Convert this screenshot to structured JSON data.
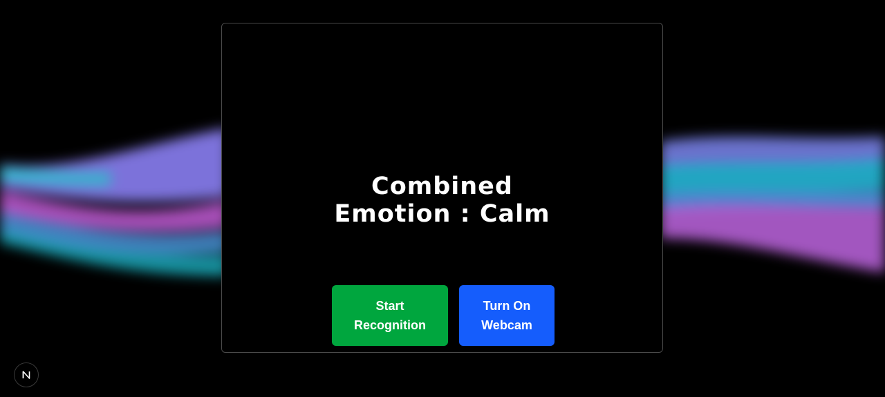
{
  "main": {
    "title_line1": "Combined",
    "title_line2": "Emotion : Calm"
  },
  "actions": {
    "start_label_line1": "Start",
    "start_label_line2": "Recognition",
    "webcam_label_line1": "Turn On",
    "webcam_label_line2": "Webcam"
  },
  "colors": {
    "background": "#000000",
    "start_button": "#00a63e",
    "webcam_button": "#155dfc",
    "wave_teal": "#1fb8c8",
    "wave_violet": "#8f7cf0",
    "wave_pink": "#c45fd8",
    "wave_blue": "#5aa8f0"
  },
  "icons": {
    "dev_badge": "next-logo-icon"
  }
}
